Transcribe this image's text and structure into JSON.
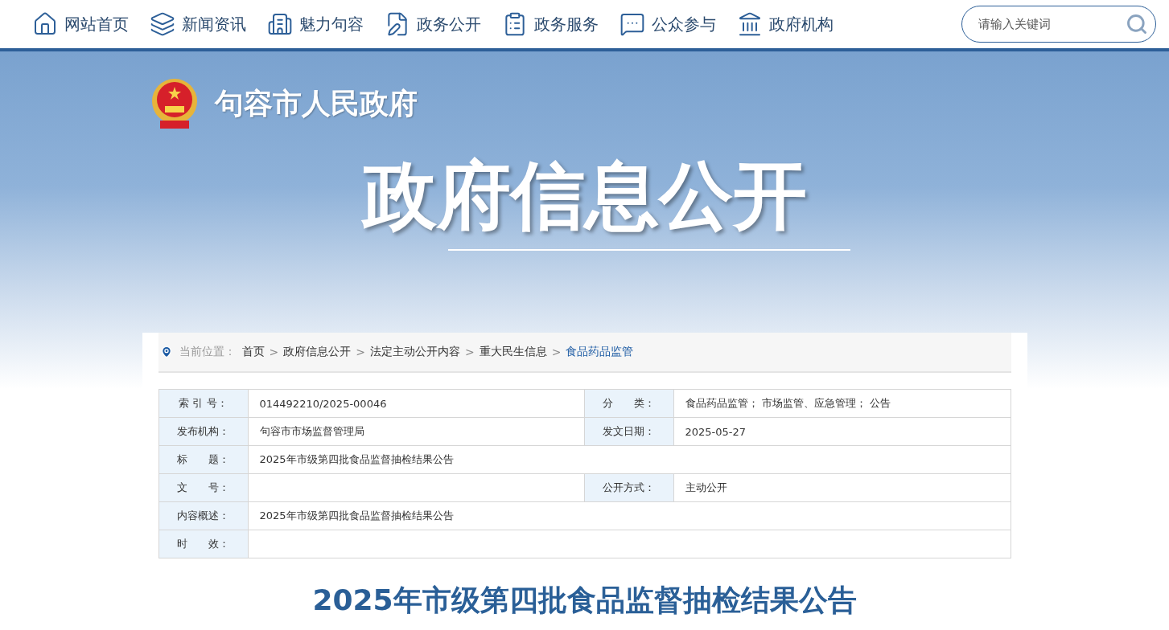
{
  "nav": [
    {
      "kind": "home",
      "label": "网站首页"
    },
    {
      "kind": "layers",
      "label": "新闻资讯"
    },
    {
      "kind": "city",
      "label": "魅力句容"
    },
    {
      "kind": "edit",
      "label": "政务公开"
    },
    {
      "kind": "clipboard",
      "label": "政务服务"
    },
    {
      "kind": "chat",
      "label": "公众参与"
    },
    {
      "kind": "bank",
      "label": "政府机构"
    }
  ],
  "search": {
    "placeholder": "请输入关键词"
  },
  "site_name": "句容市人民政府",
  "banner_title": "政府信息公开",
  "breadcrumb": {
    "prefix": "当前位置：",
    "separator": ">",
    "items": [
      {
        "label": "首页",
        "selected": false
      },
      {
        "label": "政府信息公开",
        "selected": false
      },
      {
        "label": "法定主动公开内容",
        "selected": false
      },
      {
        "label": "重大民生信息",
        "selected": false
      },
      {
        "label": "食品药品监管",
        "selected": true
      }
    ]
  },
  "info_table": [
    {
      "cells": [
        {
          "label": "索 引 号：",
          "value": "014492210/2025-00046"
        },
        {
          "label": "分　　类：",
          "value": "食品药品监管； 市场监管、应急管理； 公告"
        }
      ]
    },
    {
      "cells": [
        {
          "label": "发布机构：",
          "value": "句容市市场监督管理局"
        },
        {
          "label": "发文日期：",
          "value": "2025-05-27"
        }
      ]
    },
    {
      "cells": [
        {
          "label": "标　　题：",
          "value": "2025年市级第四批食品监督抽检结果公告"
        }
      ]
    },
    {
      "cells": [
        {
          "label": "文　　号："
        },
        {
          "label": "公开方式：",
          "value": "主动公开"
        }
      ]
    },
    {
      "cells": [
        {
          "label": "内容概述：",
          "value": "2025年市级第四批食品监督抽检结果公告"
        }
      ]
    },
    {
      "cells": [
        {
          "label": "时　　效："
        }
      ]
    }
  ],
  "article_title": "2025年市级第四批食品监督抽检结果公告"
}
